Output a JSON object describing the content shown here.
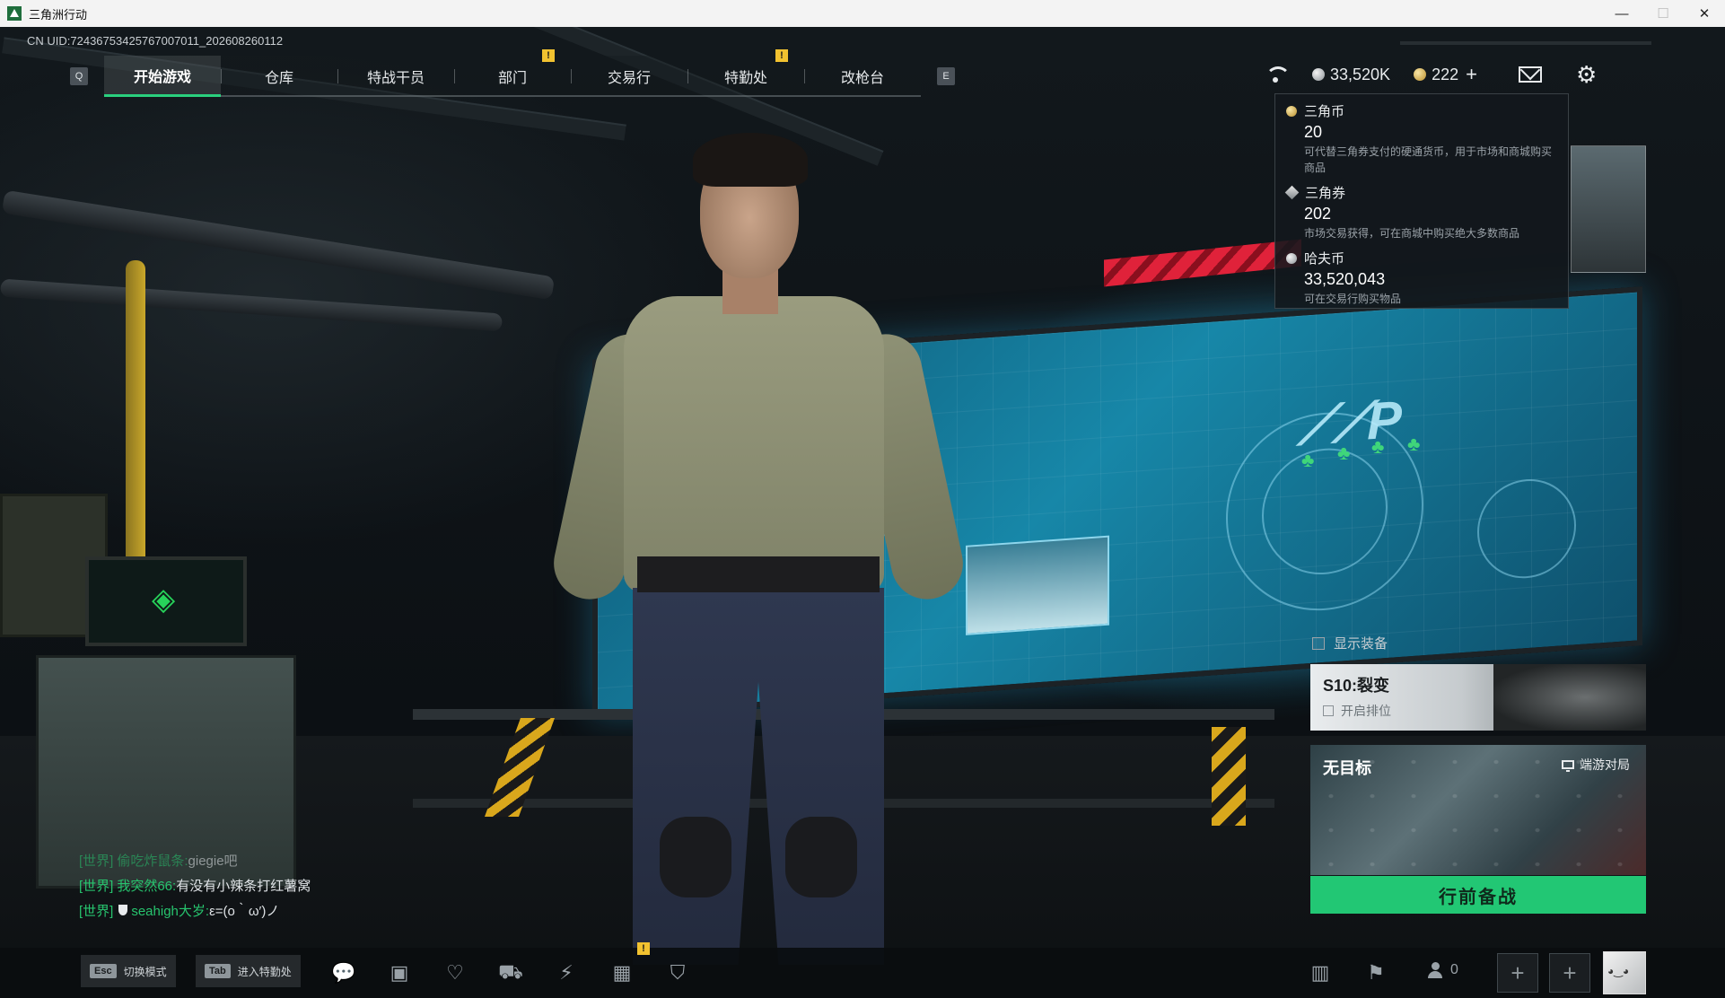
{
  "window": {
    "title": "三角洲行动",
    "controls": {
      "minimize": "—",
      "maximize": "☐",
      "close": "✕"
    }
  },
  "uid": "CN UID:7243675342576700​7011_202608260112",
  "nav": {
    "left_key": "Q",
    "right_key": "E",
    "tabs": [
      {
        "label": "开始游戏",
        "active": true,
        "badge": ""
      },
      {
        "label": "仓库",
        "active": false,
        "badge": ""
      },
      {
        "label": "特战干员",
        "active": false,
        "badge": ""
      },
      {
        "label": "部门",
        "active": false,
        "badge": "!"
      },
      {
        "label": "交易行",
        "active": false,
        "badge": ""
      },
      {
        "label": "特勤处",
        "active": false,
        "badge": "!"
      },
      {
        "label": "改枪台",
        "active": false,
        "badge": ""
      }
    ]
  },
  "topbar": {
    "haf_coin": "33,520K",
    "tri_ticket": "222",
    "plus": "+"
  },
  "currency_popup": {
    "items": [
      {
        "icon": "coin-gold",
        "name": "三角币",
        "amount": "20",
        "desc": "可代替三角券支付的硬通货币，用于市场和商城购买商品"
      },
      {
        "icon": "diamond",
        "name": "三角券",
        "amount": "202",
        "desc": "市场交易获得，可在商城中购买绝大多数商品"
      },
      {
        "icon": "coin-silver",
        "name": "哈夫币",
        "amount": "33,520,043",
        "desc": "可在交易行购买物品"
      }
    ]
  },
  "show_gear": {
    "label": "显示装备"
  },
  "season": {
    "title": "S10:裂变",
    "subtitle": "开启排位"
  },
  "mode": {
    "title": "无目标",
    "tag": "端游对局"
  },
  "ready_button": "行前备战",
  "chat": [
    {
      "channel": "[世界]",
      "name": "偷吃炸鼠条:",
      "message": "giegie吧",
      "faded": true,
      "shield": false
    },
    {
      "channel": "[世界]",
      "name": "我突然66:",
      "message": "有没有小辣条打红薯窝",
      "faded": false,
      "shield": false
    },
    {
      "channel": "[世界]",
      "name": "seahigh大岁:",
      "message": "ε=(ο｀ω′)ノ",
      "faded": false,
      "shield": true
    }
  ],
  "bottom": {
    "esc": {
      "key": "Esc",
      "label": "切换模式"
    },
    "tab": {
      "key": "Tab",
      "label": "进入特勤处"
    },
    "party_count": "0",
    "slot_plus": "+"
  },
  "colors": {
    "accent": "#22c774",
    "badge": "#f2c230"
  }
}
